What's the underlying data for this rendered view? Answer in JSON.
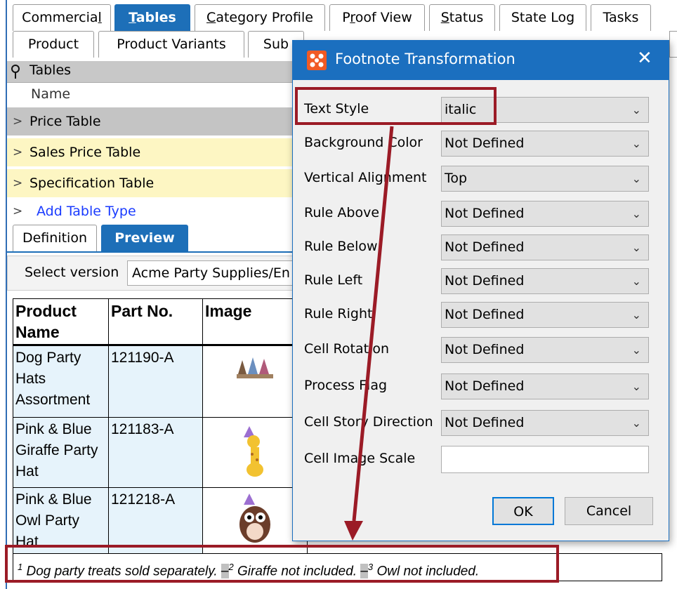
{
  "tabs_row1": [
    {
      "label": "Commercial",
      "pre": "Commercia",
      "ul": "l",
      "post": ""
    },
    {
      "label": "Tables",
      "pre": "",
      "ul": "T",
      "post": "ables"
    },
    {
      "label": "Category Profile",
      "pre": "",
      "ul": "C",
      "post": "ategory Profile"
    },
    {
      "label": "Proof View",
      "pre": "P",
      "ul": "r",
      "post": "oof View"
    },
    {
      "label": "Status",
      "pre": "",
      "ul": "S",
      "post": "tatus"
    },
    {
      "label": "State Log",
      "pre": "State Log",
      "ul": "",
      "post": ""
    },
    {
      "label": "Tasks",
      "pre": "Tasks",
      "ul": "",
      "post": ""
    }
  ],
  "tabs_row2": [
    "Product",
    "Product Variants",
    "Sub"
  ],
  "tables_panel": {
    "header": "Tables",
    "column_name": "Name",
    "rows": [
      "Price Table",
      "Sales Price Table",
      "Specification Table"
    ],
    "add_link": "Add Table Type"
  },
  "subtabs": [
    "Definition",
    "Preview"
  ],
  "version": {
    "label": "Select version",
    "value": "Acme Party Supplies/En"
  },
  "preview_table": {
    "headers": [
      "Product Name",
      "Part No.",
      "Image"
    ],
    "rows": [
      {
        "name": "Dog Party Hats Assortment",
        "part": "121190-A"
      },
      {
        "name": "Pink & Blue Giraffe Party Hat",
        "part": "121183-A"
      },
      {
        "name": "Pink & Blue Owl Party Hat",
        "part": "121218-A"
      }
    ]
  },
  "footnotes": [
    {
      "num": "1",
      "text": "Dog party treats sold separately."
    },
    {
      "num": "2",
      "text": "Giraffe not included."
    },
    {
      "num": "3",
      "text": "Owl not included."
    }
  ],
  "footnote_separator": "–",
  "dialog": {
    "title": "Footnote Transformation",
    "close_glyph": "✕",
    "fields": [
      {
        "label": "Text Style",
        "value": "italic"
      },
      {
        "label": "Background Color",
        "value": "Not Defined"
      },
      {
        "label": "Vertical Alignment",
        "value": "Top"
      },
      {
        "label": "Rule Above",
        "value": "Not Defined"
      },
      {
        "label": "Rule Below",
        "value": "Not Defined"
      },
      {
        "label": "Rule Left",
        "value": "Not Defined"
      },
      {
        "label": "Rule Right",
        "value": "Not Defined"
      },
      {
        "label": "Cell Rotation",
        "value": "Not Defined"
      },
      {
        "label": "Process Flag",
        "value": "Not Defined"
      },
      {
        "label": "Cell Story Direction",
        "value": "Not Defined"
      }
    ],
    "text_field": {
      "label": "Cell Image Scale",
      "value": ""
    },
    "ok": "OK",
    "cancel": "Cancel"
  },
  "colors": {
    "accent": "#1b6fbf",
    "highlight_row": "#fdf6c3",
    "annotation": "#9b1b26",
    "app_icon": "#f15a24"
  }
}
